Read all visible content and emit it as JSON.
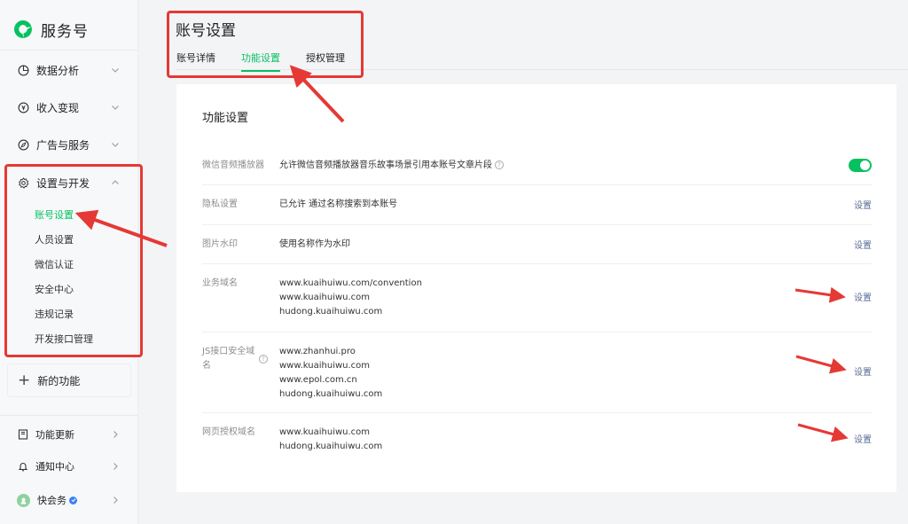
{
  "brand": {
    "name": "服务号"
  },
  "sidebar": {
    "items": [
      {
        "label": "数据分析",
        "icon": "chart-icon"
      },
      {
        "label": "收入变现",
        "icon": "coin-icon"
      },
      {
        "label": "广告与服务",
        "icon": "compass-icon"
      },
      {
        "label": "设置与开发",
        "icon": "gear-icon",
        "expanded": true
      }
    ],
    "sub_items": [
      {
        "label": "账号设置",
        "active": true
      },
      {
        "label": "人员设置"
      },
      {
        "label": "微信认证"
      },
      {
        "label": "安全中心"
      },
      {
        "label": "违规记录"
      },
      {
        "label": "开发接口管理"
      }
    ],
    "new_feature": "新的功能",
    "bottom": [
      {
        "label": "功能更新",
        "icon": "book-icon"
      },
      {
        "label": "通知中心",
        "icon": "bell-icon"
      },
      {
        "label": "快会务",
        "icon": "avatar"
      }
    ]
  },
  "header": {
    "title": "账号设置",
    "tabs": [
      {
        "label": "账号详情"
      },
      {
        "label": "功能设置",
        "active": true
      },
      {
        "label": "授权管理"
      }
    ]
  },
  "settings": {
    "title": "功能设置",
    "rows": [
      {
        "label": "微信音频播放器",
        "value": "允许微信音频播放器音乐故事场景引用本账号文章片段",
        "control": "toggle",
        "enabled": true
      },
      {
        "label": "隐私设置",
        "value": "已允许  通过名称搜索到本账号",
        "action": "设置"
      },
      {
        "label": "图片水印",
        "value": "使用名称作为水印",
        "action": "设置"
      },
      {
        "label": "业务域名",
        "values": [
          "www.kuaihuiwu.com/convention",
          "www.kuaihuiwu.com",
          "hudong.kuaihuiwu.com"
        ],
        "action": "设置"
      },
      {
        "label_lines": [
          "JS接口安全域",
          "名"
        ],
        "values": [
          "www.zhanhui.pro",
          "www.kuaihuiwu.com",
          "www.epol.com.cn",
          "hudong.kuaihuiwu.com"
        ],
        "action": "设置"
      },
      {
        "label": "网页授权域名",
        "values": [
          "www.kuaihuiwu.com",
          "hudong.kuaihuiwu.com"
        ],
        "action": "设置"
      }
    ]
  },
  "colors": {
    "accent": "#07c160",
    "link": "#576b95",
    "annotation": "#e53935"
  }
}
